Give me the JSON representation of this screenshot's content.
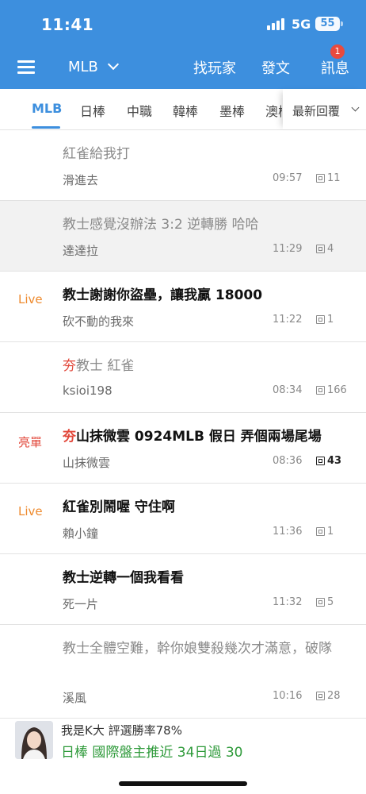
{
  "status": {
    "time": "11:41",
    "network": "5G",
    "battery": "55"
  },
  "nav": {
    "league": "MLB",
    "find_players": "找玩家",
    "post": "發文",
    "messages": "訊息",
    "message_count": "1"
  },
  "tabs": [
    {
      "label": "MLB",
      "active": true
    },
    {
      "label": "日棒"
    },
    {
      "label": "中職"
    },
    {
      "label": "韓棒"
    },
    {
      "label": "墨棒"
    },
    {
      "label": "澳棒"
    }
  ],
  "sort": {
    "label": "最新回覆"
  },
  "posts": [
    {
      "tag": "",
      "title": "紅雀給我打",
      "author": "滑進去",
      "time": "09:57",
      "replies": "11",
      "read": true
    },
    {
      "tag": "",
      "title": "教士感覺沒辦法 3:2 逆轉勝 哈哈",
      "author": "達達拉",
      "time": "11:29",
      "replies": "4",
      "read": true,
      "highlight": true
    },
    {
      "tag": "Live",
      "title": "教士謝謝你盜壘，讓我贏 18000",
      "author": "砍不動的我來",
      "time": "11:22",
      "replies": "1"
    },
    {
      "tag": "",
      "prefix": "夯",
      "title": "教士 紅雀",
      "author": "ksioi198",
      "time": "08:34",
      "replies": "166",
      "read": true
    },
    {
      "tag": "亮單",
      "prefix": "夯",
      "title": "山抹微雲  0924MLB  假日 弄個兩場尾場",
      "author": "山抹微雲",
      "time": "08:36",
      "replies": "43"
    },
    {
      "tag": "Live",
      "title": "紅雀別鬧喔 守住啊",
      "author": "賴小鐘",
      "time": "11:36",
      "replies": "1"
    },
    {
      "tag": "",
      "title": "教士逆轉一個我看看",
      "author": "死一片",
      "time": "11:32",
      "replies": "5"
    },
    {
      "tag": "",
      "title": "教士全體空難，幹你娘雙殺幾次才滿意，破隊",
      "author": "溪風",
      "time": "10:16",
      "replies": "28",
      "read": true
    }
  ],
  "banner": {
    "line1": "我是K大 評選勝率78%",
    "line2": "日棒 國際盤主推近 34日過 30"
  },
  "colors": {
    "accent": "#3d8fde",
    "live": "#ee8a2e",
    "hot": "#e2483b",
    "banner_text": "#2e9a3a"
  }
}
